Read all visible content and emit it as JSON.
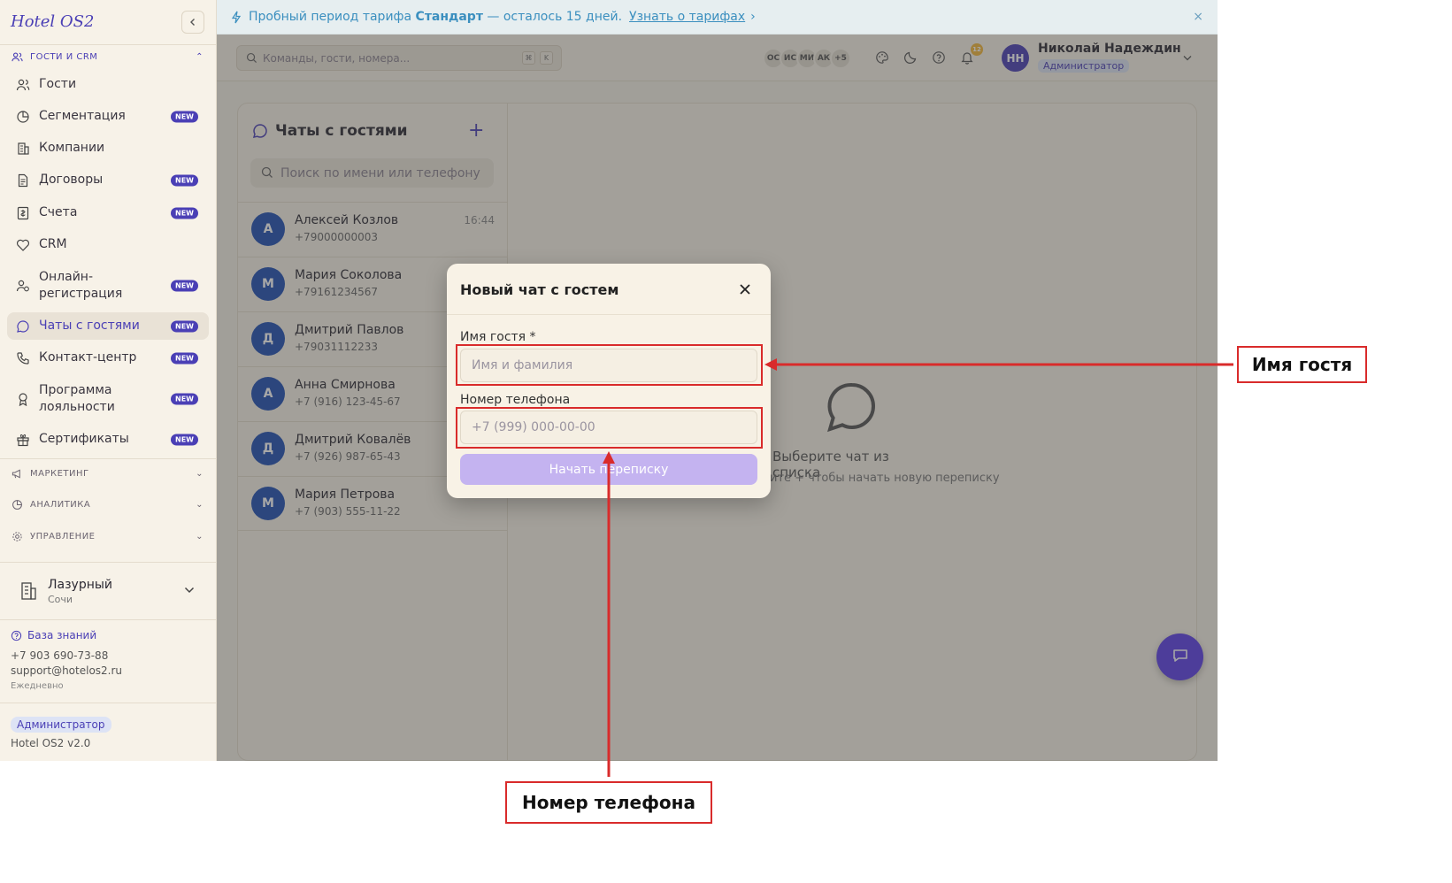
{
  "app": {
    "brand": "Hotel OS2"
  },
  "sidebar": {
    "section_guests": "ГОСТИ И CRM",
    "items": [
      {
        "label": "Гости",
        "badge": ""
      },
      {
        "label": "Сегментация",
        "badge": "NEW"
      },
      {
        "label": "Компании",
        "badge": ""
      },
      {
        "label": "Договоры",
        "badge": "NEW"
      },
      {
        "label": "Счета",
        "badge": "NEW"
      },
      {
        "label": "CRM",
        "badge": ""
      },
      {
        "label": "Онлайн-регистрация",
        "badge": "NEW"
      },
      {
        "label": "Чаты с гостями",
        "badge": "NEW"
      },
      {
        "label": "Контакт-центр",
        "badge": "NEW"
      },
      {
        "label": "Программа лояльности",
        "badge": "NEW"
      },
      {
        "label": "Сертификаты",
        "badge": "NEW"
      }
    ],
    "section_marketing": "МАРКЕТИНГ",
    "section_analytics": "АНАЛИТИКА",
    "section_management": "УПРАВЛЕНИЕ",
    "hotel_name": "Лазурный",
    "hotel_city": "Сочи",
    "knowledge_base": "База знаний",
    "support_phone": "+7 903 690-73-88",
    "support_email": "support@hotelos2.ru",
    "support_hours": "Ежедневно",
    "role": "Администратор",
    "version": "Hotel OS2 v2.0"
  },
  "banner": {
    "prefix": "Пробный период тарифа",
    "plan": "Стандарт",
    "suffix": "— осталось 15 дней.",
    "link": "Узнать о тарифах",
    "link_arrow": "›",
    "close": "×"
  },
  "header": {
    "search_placeholder": "Команды, гости, номера...",
    "kbd1": "⌘",
    "kbd2": "K",
    "avatars": [
      "ОС",
      "ИС",
      "МИ",
      "АК",
      "+5"
    ],
    "notification_count": "12",
    "user_initials": "НН",
    "user_name": "Николай Надеждин",
    "user_role": "Администратор"
  },
  "chats": {
    "title": "Чаты с гостями",
    "add": "+",
    "search_placeholder": "Поиск по имени или телефону",
    "list": [
      {
        "initial": "А",
        "name": "Алексей Козлов",
        "phone": "+79000000003",
        "time": "16:44"
      },
      {
        "initial": "М",
        "name": "Мария Соколова",
        "phone": "+79161234567",
        "time": ""
      },
      {
        "initial": "Д",
        "name": "Дмитрий Павлов",
        "phone": "+79031112233",
        "time": ""
      },
      {
        "initial": "А",
        "name": "Анна Смирнова",
        "phone": "+7 (916) 123-45-67",
        "time": ""
      },
      {
        "initial": "Д",
        "name": "Дмитрий Ковалёв",
        "phone": "+7 (926) 987-65-43",
        "time": ""
      },
      {
        "initial": "М",
        "name": "Мария Петрова",
        "phone": "+7 (903) 555-11-22",
        "time": ""
      }
    ],
    "empty_title": "Выберите чат из списка",
    "empty_subtitle": "ите + чтобы начать новую переписку"
  },
  "modal": {
    "title": "Новый чат с гостем",
    "name_label": "Имя гостя *",
    "name_placeholder": "Имя и фамилия",
    "phone_label": "Номер телефона",
    "phone_placeholder": "+7 (999) 000-00-00",
    "submit": "Начать переписку"
  },
  "annotations": {
    "name_callout": "Имя гостя",
    "phone_callout": "Номер телефона"
  },
  "colors": {
    "accent": "#4a3fb5",
    "annotation": "#d92b2b",
    "submit_disabled": "#c4b3f0",
    "fab": "#5b3ee8"
  }
}
